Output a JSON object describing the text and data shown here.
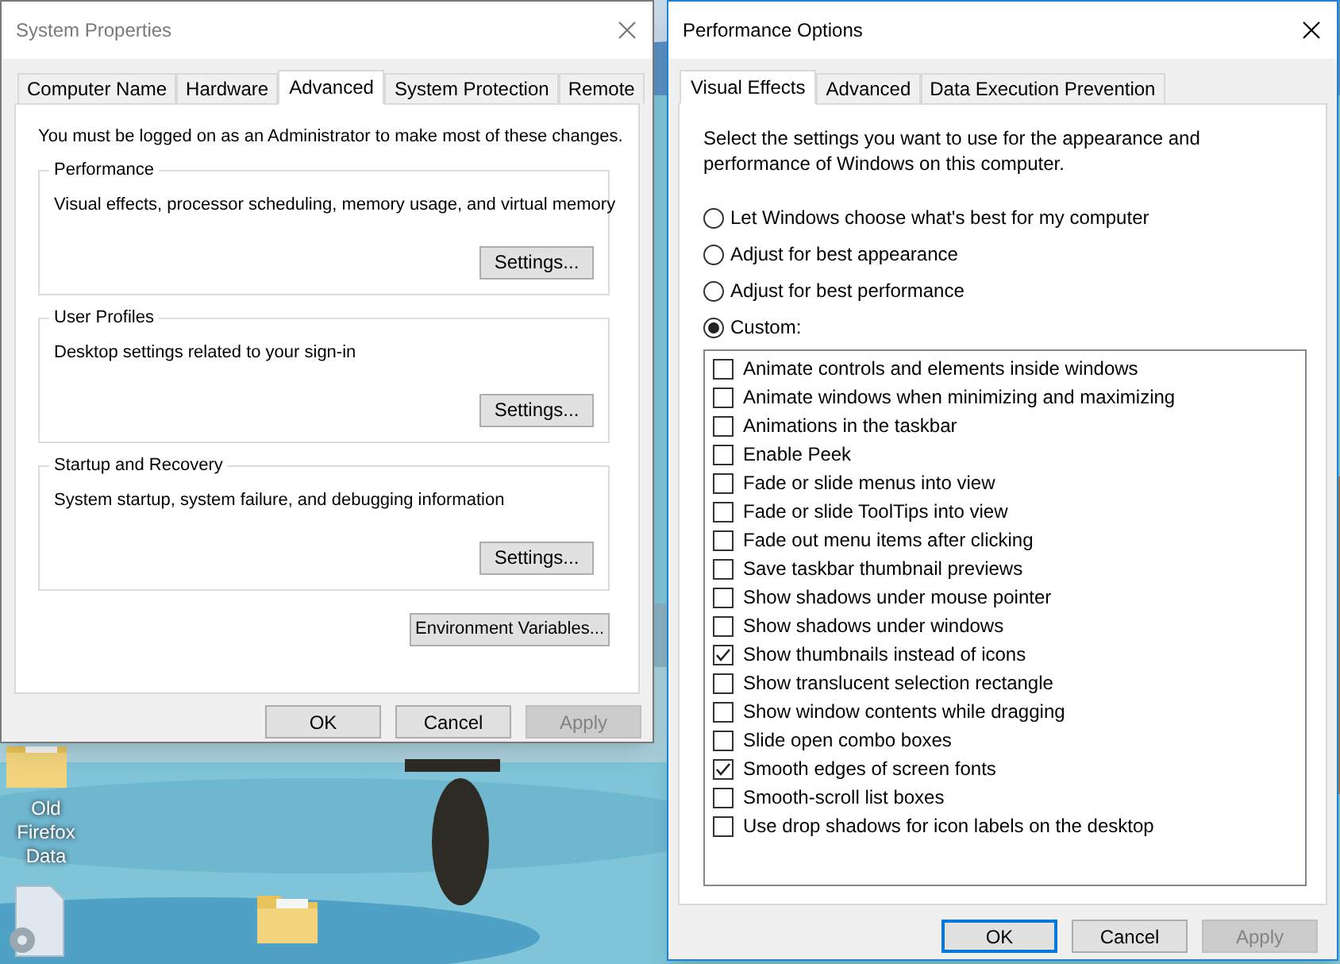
{
  "desktop": {
    "icons": [
      {
        "kind": "folder",
        "label": "Old Firefox Data"
      },
      {
        "kind": "settings-file"
      },
      {
        "kind": "folder"
      }
    ]
  },
  "system_properties": {
    "title": "System Properties",
    "active": false,
    "tabs": [
      {
        "label": "Computer Name",
        "selected": false
      },
      {
        "label": "Hardware",
        "selected": false
      },
      {
        "label": "Advanced",
        "selected": true
      },
      {
        "label": "System Protection",
        "selected": false
      },
      {
        "label": "Remote",
        "selected": false
      }
    ],
    "note": "You must be logged on as an Administrator to make most of these changes.",
    "groups": [
      {
        "title": "Performance",
        "description": "Visual effects, processor scheduling, memory usage, and virtual memory",
        "button": "Settings..."
      },
      {
        "title": "User Profiles",
        "description": "Desktop settings related to your sign-in",
        "button": "Settings..."
      },
      {
        "title": "Startup and Recovery",
        "description": "System startup, system failure, and debugging information",
        "button": "Settings..."
      }
    ],
    "environment_button": "Environment Variables...",
    "buttons": [
      {
        "label": "OK",
        "disabled": false,
        "default": false
      },
      {
        "label": "Cancel",
        "disabled": false,
        "default": false
      },
      {
        "label": "Apply",
        "disabled": true,
        "default": false
      }
    ]
  },
  "performance_options": {
    "title": "Performance Options",
    "active": true,
    "tabs": [
      {
        "label": "Visual Effects",
        "selected": true
      },
      {
        "label": "Advanced",
        "selected": false
      },
      {
        "label": "Data Execution Prevention",
        "selected": false
      }
    ],
    "intro": "Select the settings you want to use for the appearance and performance of Windows on this computer.",
    "options": [
      {
        "label": "Let Windows choose what's best for my computer",
        "selected": false
      },
      {
        "label": "Adjust for best appearance",
        "selected": false
      },
      {
        "label": "Adjust for best performance",
        "selected": false
      },
      {
        "label": "Custom:",
        "selected": true
      }
    ],
    "effects": [
      {
        "label": "Animate controls and elements inside windows",
        "checked": false
      },
      {
        "label": "Animate windows when minimizing and maximizing",
        "checked": false
      },
      {
        "label": "Animations in the taskbar",
        "checked": false
      },
      {
        "label": "Enable Peek",
        "checked": false
      },
      {
        "label": "Fade or slide menus into view",
        "checked": false
      },
      {
        "label": "Fade or slide ToolTips into view",
        "checked": false
      },
      {
        "label": "Fade out menu items after clicking",
        "checked": false
      },
      {
        "label": "Save taskbar thumbnail previews",
        "checked": false
      },
      {
        "label": "Show shadows under mouse pointer",
        "checked": false
      },
      {
        "label": "Show shadows under windows",
        "checked": false
      },
      {
        "label": "Show thumbnails instead of icons",
        "checked": true
      },
      {
        "label": "Show translucent selection rectangle",
        "checked": false
      },
      {
        "label": "Show window contents while dragging",
        "checked": false
      },
      {
        "label": "Slide open combo boxes",
        "checked": false
      },
      {
        "label": "Smooth edges of screen fonts",
        "checked": true
      },
      {
        "label": "Smooth-scroll list boxes",
        "checked": false
      },
      {
        "label": "Use drop shadows for icon labels on the desktop",
        "checked": false
      }
    ],
    "buttons": [
      {
        "label": "OK",
        "disabled": false,
        "default": true
      },
      {
        "label": "Cancel",
        "disabled": false,
        "default": false
      },
      {
        "label": "Apply",
        "disabled": true,
        "default": false
      }
    ]
  }
}
